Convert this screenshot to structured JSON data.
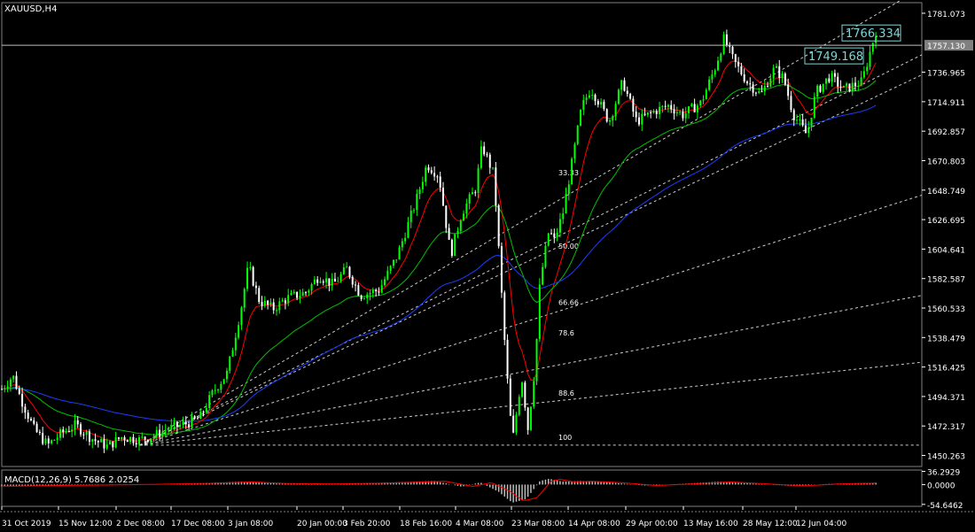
{
  "symbol": "XAUUSD,H4",
  "macd_label": "MACD(12,26,9) 5.7686 2.0254",
  "current_price": "1757.130",
  "callouts": [
    "1766.334",
    "1749.168"
  ],
  "colors": {
    "background": "#000000",
    "grid": "#808080",
    "bull": "#00ff00",
    "bear": "#ffffff",
    "ma_fast": "#ff0000",
    "ma_mid": "#00c000",
    "ma_slow": "#1e3cff",
    "price_line": "#c0c0c0",
    "callout": "#7fd4d4",
    "fib": "#cccccc"
  },
  "chart_data": [
    {
      "type": "candlestick",
      "title": "XAUUSD,H4",
      "y_ticks": [
        "1781.073",
        "1757.130",
        "1736.965",
        "1714.911",
        "1692.857",
        "1670.803",
        "1648.749",
        "1626.695",
        "1604.641",
        "1582.587",
        "1560.533",
        "1538.479",
        "1516.425",
        "1494.371",
        "1472.317",
        "1450.263"
      ],
      "x_ticks": [
        "31 Oct 2019",
        "15 Nov 12:00",
        "2 Dec 08:00",
        "17 Dec 08:00",
        "3 Jan 08:00",
        "20 Jan 00:00",
        "3 Feb 20:00",
        "18 Feb 16:00",
        "4 Mar 08:00",
        "23 Mar 08:00",
        "14 Apr 08:00",
        "29 Apr 00:00",
        "13 May 16:00",
        "28 May 12:00",
        "12 Jun 04:00"
      ],
      "ylim": [
        1442,
        1789
      ],
      "price_path": [
        [
          0,
          1500
        ],
        [
          0.012,
          1510
        ],
        [
          0.02,
          1494
        ],
        [
          0.035,
          1470
        ],
        [
          0.05,
          1458
        ],
        [
          0.065,
          1467
        ],
        [
          0.08,
          1473
        ],
        [
          0.1,
          1462
        ],
        [
          0.115,
          1457
        ],
        [
          0.13,
          1464
        ],
        [
          0.15,
          1462
        ],
        [
          0.165,
          1465
        ],
        [
          0.18,
          1470
        ],
        [
          0.2,
          1474
        ],
        [
          0.215,
          1478
        ],
        [
          0.23,
          1498
        ],
        [
          0.245,
          1512
        ],
        [
          0.26,
          1560
        ],
        [
          0.268,
          1592
        ],
        [
          0.28,
          1566
        ],
        [
          0.295,
          1560
        ],
        [
          0.31,
          1568
        ],
        [
          0.33,
          1572
        ],
        [
          0.345,
          1585
        ],
        [
          0.36,
          1578
        ],
        [
          0.375,
          1590
        ],
        [
          0.39,
          1570
        ],
        [
          0.41,
          1574
        ],
        [
          0.43,
          1600
        ],
        [
          0.45,
          1640
        ],
        [
          0.462,
          1668
        ],
        [
          0.475,
          1660
        ],
        [
          0.488,
          1600
        ],
        [
          0.5,
          1632
        ],
        [
          0.515,
          1650
        ],
        [
          0.522,
          1682
        ],
        [
          0.535,
          1660
        ],
        [
          0.548,
          1520
        ],
        [
          0.555,
          1460
        ],
        [
          0.565,
          1510
        ],
        [
          0.572,
          1470
        ],
        [
          0.58,
          1520
        ],
        [
          0.585,
          1580
        ],
        [
          0.595,
          1620
        ],
        [
          0.6,
          1610
        ],
        [
          0.61,
          1632
        ],
        [
          0.62,
          1670
        ],
        [
          0.63,
          1710
        ],
        [
          0.64,
          1725
        ],
        [
          0.648,
          1716
        ],
        [
          0.66,
          1700
        ],
        [
          0.675,
          1730
        ],
        [
          0.69,
          1700
        ],
        [
          0.71,
          1708
        ],
        [
          0.725,
          1712
        ],
        [
          0.74,
          1705
        ],
        [
          0.76,
          1714
        ],
        [
          0.775,
          1740
        ],
        [
          0.785,
          1762
        ],
        [
          0.795,
          1746
        ],
        [
          0.81,
          1730
        ],
        [
          0.825,
          1720
        ],
        [
          0.84,
          1740
        ],
        [
          0.85,
          1732
        ],
        [
          0.86,
          1706
        ],
        [
          0.875,
          1690
        ],
        [
          0.885,
          1722
        ],
        [
          0.9,
          1734
        ],
        [
          0.915,
          1724
        ],
        [
          0.935,
          1730
        ],
        [
          0.95,
          1768
        ]
      ],
      "current_price": 1757.13,
      "fib_fan": {
        "origin_y": 1458,
        "levels": [
          "33.33",
          "50.00",
          "66.66",
          "78.6",
          "88.6",
          "100"
        ],
        "end_y": [
          1800,
          1750,
          1735,
          1645,
          1570,
          1520,
          1458
        ]
      },
      "callouts": [
        1766.334,
        1749.168
      ]
    },
    {
      "type": "area",
      "title": "MACD(12,26,9) 5.7686 2.0254",
      "y_ticks": [
        "36.2929",
        "0.0000",
        "-54.6462"
      ],
      "ylim": [
        -60,
        40
      ],
      "histogram_path": [
        [
          0,
          -5
        ],
        [
          0.05,
          -3
        ],
        [
          0.12,
          -1
        ],
        [
          0.18,
          2
        ],
        [
          0.22,
          4
        ],
        [
          0.26,
          8
        ],
        [
          0.3,
          3
        ],
        [
          0.35,
          2
        ],
        [
          0.4,
          4
        ],
        [
          0.45,
          8
        ],
        [
          0.47,
          10
        ],
        [
          0.5,
          -6
        ],
        [
          0.52,
          6
        ],
        [
          0.54,
          -20
        ],
        [
          0.555,
          -50
        ],
        [
          0.57,
          -40
        ],
        [
          0.585,
          10
        ],
        [
          0.595,
          16
        ],
        [
          0.61,
          8
        ],
        [
          0.63,
          10
        ],
        [
          0.66,
          6
        ],
        [
          0.7,
          -3
        ],
        [
          0.74,
          2
        ],
        [
          0.78,
          8
        ],
        [
          0.82,
          2
        ],
        [
          0.86,
          -4
        ],
        [
          0.9,
          2
        ],
        [
          0.95,
          5
        ]
      ]
    }
  ]
}
